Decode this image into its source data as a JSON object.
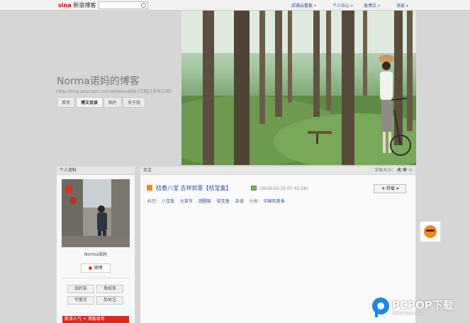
{
  "topbar": {
    "logo": "sina",
    "logo_sub": "新浪博客",
    "search_placeholder": "",
    "nav": [
      {
        "label": "店铺云看板"
      },
      {
        "label": "个人中心"
      },
      {
        "label": "发博文"
      },
      {
        "label": "消息"
      }
    ]
  },
  "header": {
    "blog_title": "Norma诺妈的博客",
    "blog_url": "http://blog.sina.com.cn/normalovelife  [订阅] [手机订阅]",
    "nav": [
      {
        "label": "首页"
      },
      {
        "label": "博文目录"
      },
      {
        "label": "图片"
      },
      {
        "label": "关于我"
      }
    ]
  },
  "sidebar": {
    "title": "个人资料",
    "profile_name": "Norma诺妈",
    "weibo": "微博",
    "buttons": [
      "加好友",
      "发纸条",
      "写留言",
      "加关注"
    ],
    "banner": "新浪人气 + 博客周年"
  },
  "main": {
    "title": "正文",
    "font_size_label": "字体大小：",
    "font_sizes": [
      "大",
      "中",
      "小"
    ],
    "post": {
      "title": "桔香八宝 吉祥如意【桔宝盒】",
      "time": "(2016-02-25 07:42:28)",
      "share_label": "转载",
      "tags_label": "标签：",
      "tags": [
        "八宝饭",
        "元宵节",
        "团圆饭",
        "桔宝盒",
        "杂谈"
      ],
      "category_label": "分类：",
      "category": "中国风美食"
    }
  },
  "watermark": {
    "brand": "PCPOP下载",
    "sub": "PCPOP Download"
  },
  "colors": {
    "link": "#2b4a8c",
    "accent": "#f08a1a",
    "brand_red": "#d92a1c"
  }
}
